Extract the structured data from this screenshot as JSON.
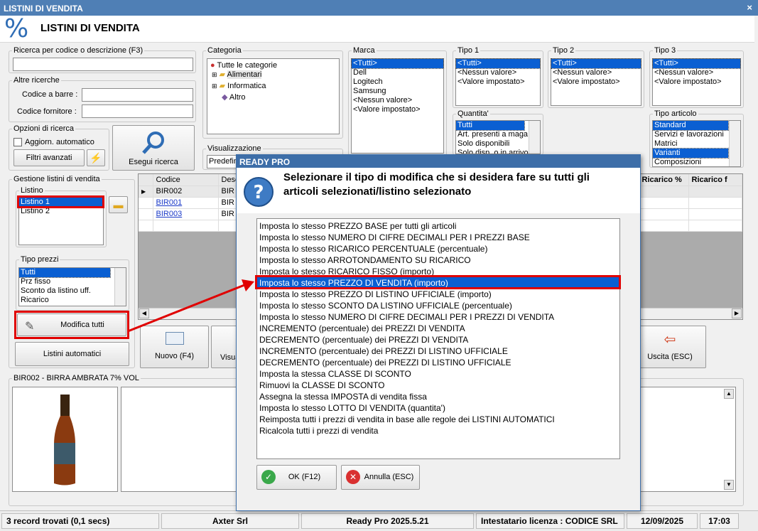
{
  "window": {
    "title": "LISTINI DI VENDITA",
    "close": "×",
    "header_icon": "%",
    "header_title": "LISTINI DI VENDITA"
  },
  "search": {
    "label": "Ricerca per codice o descrizione (F3)",
    "value": ""
  },
  "altre": {
    "label": "Altre ricerche",
    "barcode_label": "Codice a barre :",
    "supplier_label": "Codice fornitore :"
  },
  "opzioni": {
    "label": "Opzioni di ricerca",
    "auto_label": "Aggiorn. automatico",
    "filters_label": "Filtri avanzati",
    "bolt_icon": "lightning-icon",
    "search_button": "Esegui ricerca"
  },
  "categoria": {
    "label": "Categoria",
    "root": "Tutte le categorie",
    "items": [
      "Alimentari",
      "Informatica",
      "Altro"
    ]
  },
  "visualizzazione": {
    "label": "Visualizzazione",
    "value": "Predefin"
  },
  "marca": {
    "label": "Marca",
    "items": [
      "<Tutti>",
      "Dell",
      "Logitech",
      "Samsung",
      "<Nessun valore>",
      "<Valore impostato>"
    ]
  },
  "tipo1": {
    "label": "Tipo 1",
    "items": [
      "<Tutti>",
      "<Nessun valore>",
      "<Valore impostato>"
    ]
  },
  "tipo2": {
    "label": "Tipo 2",
    "items": [
      "<Tutti>",
      "<Nessun valore>",
      "<Valore impostato>"
    ]
  },
  "tipo3": {
    "label": "Tipo 3",
    "items": [
      "<Tutti>",
      "<Nessun valore>",
      "<Valore impostato>"
    ]
  },
  "quantita": {
    "label": "Quantita'",
    "items": [
      "Tutti",
      "Art. presenti a maga",
      "Solo disponibili",
      "Solo disp. o in arrivo"
    ]
  },
  "tipo_articolo": {
    "label": "Tipo articolo",
    "items": [
      "Standard",
      "Servizi e lavorazioni",
      "Matrici",
      "Varianti",
      "Composizioni"
    ]
  },
  "gestione": {
    "label": "Gestione listini di vendita",
    "listino_label": "Listino",
    "listini": [
      "Listino 1",
      "Listino 2"
    ],
    "tipo_prezzi_label": "Tipo prezzi",
    "tipi": [
      "Tutti",
      "Prz fisso",
      "Sconto da listino uff.",
      "Ricarico"
    ],
    "modifica_tutti": "Modifica tutti",
    "listini_automatici": "Listini automatici"
  },
  "grid": {
    "headers": [
      "Codice",
      "Desc",
      "Ricarico %",
      "Ricarico f"
    ],
    "rows": [
      {
        "code": "BIR002",
        "desc": "BIR"
      },
      {
        "code": "BIR001",
        "desc": "BIR"
      },
      {
        "code": "BIR003",
        "desc": "BIR"
      }
    ]
  },
  "toolbar": {
    "nuovo": "Nuovo (F4)",
    "visua": "Visua",
    "uscita": "Uscita (ESC)"
  },
  "detail": {
    "label": "BIR002 - BIRRA AMBRATA 7% VOL"
  },
  "status": {
    "records": "3 record trovati (0,1 secs)",
    "company": "Axter Srl",
    "version": "Ready Pro 2025.5.21",
    "license": "Intestatario licenza : CODICE SRL",
    "date": "12/09/2025",
    "time": "17:03"
  },
  "dialog": {
    "title": "READY PRO",
    "question": "Selezionare il tipo di modifica che si desidera fare su tutti gli articoli selezionati/listino selezionato",
    "ok": "OK (F12)",
    "cancel": "Annulla (ESC)",
    "options": [
      "Imposta lo stesso PREZZO BASE per tutti gli articoli",
      "Imposta lo stesso NUMERO DI CIFRE DECIMALI PER I PREZZI BASE",
      "Imposta lo stesso RICARICO PERCENTUALE (percentuale)",
      "Imposta lo stesso ARROTONDAMENTO SU RICARICO",
      "Imposta lo stesso RICARICO FISSO (importo)",
      "Imposta lo stesso PREZZO DI VENDITA (importo)",
      "Imposta lo stesso PREZZO DI LISTINO UFFICIALE (importo)",
      "Imposta lo stesso SCONTO DA LISTINO UFFICIALE (percentuale)",
      "Imposta lo stesso NUMERO DI CIFRE DECIMALI PER I PREZZI DI VENDITA",
      "INCREMENTO (percentuale) dei PREZZI DI VENDITA",
      "DECREMENTO (percentuale) dei PREZZI DI VENDITA",
      "INCREMENTO (percentuale) dei PREZZI DI LISTINO UFFICIALE",
      "DECREMENTO (percentuale) dei PREZZI DI LISTINO UFFICIALE",
      "Imposta la stessa CLASSE DI SCONTO",
      "Rimuovi la CLASSE DI SCONTO",
      "Assegna la stessa IMPOSTA di vendita fissa",
      "Imposta lo stesso LOTTO DI VENDITA (quantita')",
      "Reimposta tutti i prezzi di vendita in base alle regole dei LISTINI AUTOMATICI",
      "Ricalcola tutti i prezzi di vendita"
    ],
    "selected_index": 5
  },
  "colors": {
    "accent": "#0a5fd2",
    "highlight": "#e00000",
    "titlebar": "#4f7fb5"
  }
}
